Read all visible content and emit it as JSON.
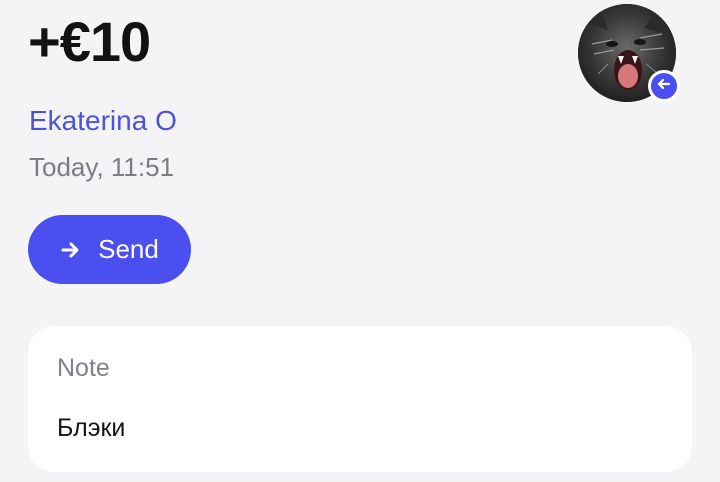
{
  "transaction": {
    "amount": "+€10",
    "counterparty": "Ekaterina O",
    "timestamp": "Today, 11:51"
  },
  "actions": {
    "send_label": "Send",
    "send_icon": "arrow-right-icon"
  },
  "avatar": {
    "badge_icon": "arrow-left-icon",
    "badge_color": "#4b4ff0"
  },
  "note": {
    "label": "Note",
    "text": "Блэки"
  },
  "colors": {
    "accent": "#4b4ff0",
    "name": "#4d52d6",
    "background": "#f4f4f6",
    "card": "#ffffff"
  }
}
